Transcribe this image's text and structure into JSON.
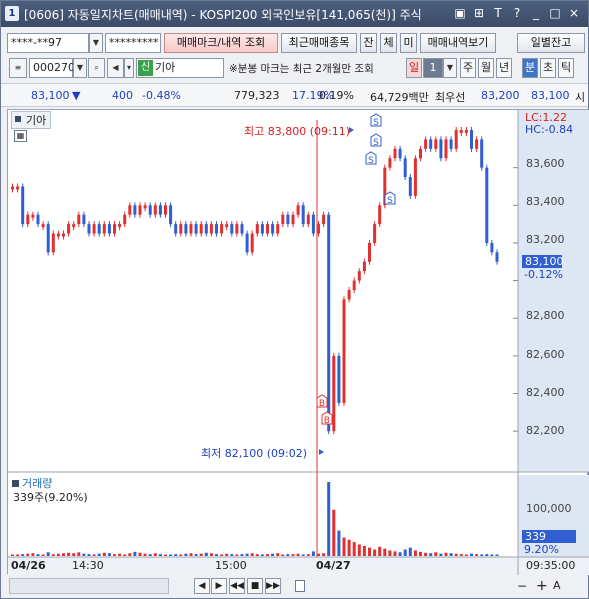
{
  "window": {
    "number": "1",
    "title": "[0606] 자동일지차트(매매내역) - KOSPI200 외국인보유[141,065(천)] 주식",
    "icons": [
      "window-icon",
      "pin-icon",
      "font-icon",
      "help-icon",
      "minimize-icon",
      "maximize-icon",
      "close-icon"
    ],
    "icon_glyphs": [
      "▣",
      "⊞",
      "T",
      "T",
      "?",
      "_",
      "□",
      "×"
    ]
  },
  "toolbar1": {
    "account": "****-**97",
    "password": "*********",
    "trade_mark_button": "매매마크/내역 조회",
    "recent_trades_button": "최근매매종목",
    "balance_button": "잔",
    "fill_button": "체",
    "unfilled_button": "미",
    "trade_history_button": "매매내역보기",
    "daily_balance_button": "일별잔고"
  },
  "toolbar2": {
    "stock_code": "000270",
    "credit_badge": "신",
    "stock_name": "기아",
    "notice": "※분봉 마크는 최근 2개월만 조회",
    "period_buttons": [
      "일",
      "주",
      "월",
      "년",
      "분",
      "초",
      "틱"
    ],
    "period_value": "1",
    "active_period": "분"
  },
  "quote": {
    "price": "83,100",
    "change_arrow": "▼",
    "change": "400",
    "change_rate": "-0.48%",
    "volume": "779,323",
    "foreign_ratio": "17.19%",
    "turnover_rate": "0.19%",
    "trade_value": "64,729백만",
    "best_label": "최우선",
    "best_ask": "83,200",
    "best_bid": "83,100",
    "overflow": "시"
  },
  "chart_panel": {
    "title": "기아",
    "lc_label": "LC:1.22",
    "hc_label": "HC:-0.84",
    "high_label": "최고 83,800 (09:11)",
    "low_label": "최저 82,100 (09:02)",
    "current_price_label": "83,100",
    "current_change_label": "-0.12%",
    "volume_title": "거래량",
    "volume_info": "339주(9.20%)",
    "volume_current_label": "339",
    "volume_current_pct": "9.20%",
    "y_tick_labels": [
      "83,600",
      "83,400",
      "83,200",
      "83,000",
      "82,800",
      "82,600",
      "82,400",
      "82,200"
    ],
    "volume_tick_labels": [
      "100,000"
    ],
    "x_labels": [
      "04/26",
      "14:30",
      "15:00",
      "04/27",
      "09:35:00"
    ],
    "colors": {
      "up": "#e03030",
      "down": "#2f5fd0",
      "axis_bg": "#dde7f3",
      "cursor_line": "#e03030"
    }
  },
  "bottombar": {
    "controls": [
      "◀",
      "▶",
      "◀◀",
      "■",
      "▶▶",
      "−",
      "+",
      "A"
    ]
  },
  "chart_data": {
    "type": "bar",
    "title": "기아",
    "ylim": [
      82100,
      83800
    ],
    "y_ticks": [
      82200,
      82400,
      82600,
      82800,
      83000,
      83200,
      83400,
      83600
    ],
    "price_marks": [
      {
        "label": "최고",
        "price": 83800,
        "time": "09:11"
      },
      {
        "label": "최저",
        "price": 82100,
        "time": "09:02"
      }
    ],
    "trade_marks": [
      {
        "type": "S",
        "time": "09:11",
        "price": 83750
      },
      {
        "type": "S",
        "time": "09:10",
        "price": 83700
      },
      {
        "type": "S",
        "time": "09:10",
        "price": 83650
      },
      {
        "type": "S",
        "time": "09:12",
        "price": 83450
      },
      {
        "type": "B",
        "time": "09:02",
        "price": 82290
      },
      {
        "type": "B",
        "time": "09:02",
        "price": 82190
      }
    ],
    "current_price": 83100,
    "series": [
      {
        "name": "가격",
        "values": [
          83500,
          83500,
          83300,
          83350,
          83350,
          83300,
          83300,
          83150,
          83250,
          83250,
          83250,
          83300,
          83300,
          83350,
          83300,
          83250,
          83300,
          83250,
          83300,
          83250,
          83300,
          83300,
          83350,
          83400,
          83350,
          83400,
          83400,
          83350,
          83400,
          83350,
          83400,
          83300,
          83250,
          83300,
          83250,
          83300,
          83250,
          83300,
          83250,
          83300,
          83250,
          83300,
          83300,
          83250,
          83300,
          83250,
          83150,
          83250,
          83300,
          83250,
          83300,
          83250,
          83300,
          83350,
          83300,
          83350,
          83400,
          83300,
          83350,
          83250,
          83300,
          83350,
          82200,
          82600,
          82350,
          82900,
          82950,
          83000,
          83050,
          83100,
          83200,
          83300,
          83400,
          83600,
          83650,
          83700,
          83650,
          83550,
          83450,
          83650,
          83700,
          83750,
          83700,
          83750,
          83650,
          83750,
          83700,
          83800,
          83800,
          83800,
          83700,
          83750,
          83600,
          83200,
          83150,
          83100
        ]
      }
    ],
    "volume_series": [
      {
        "name": "거래량",
        "values": [
          2,
          3,
          4,
          5,
          6,
          4,
          3,
          8,
          4,
          5,
          6,
          7,
          6,
          8,
          5,
          4,
          3,
          5,
          7,
          6,
          4,
          5,
          3,
          6,
          9,
          7,
          5,
          4,
          6,
          4,
          3,
          2,
          4,
          3,
          5,
          6,
          4,
          5,
          7,
          6,
          4,
          3,
          5,
          4,
          3,
          4,
          5,
          6,
          4,
          3,
          4,
          5,
          6,
          3,
          4,
          4,
          5,
          3,
          4,
          10,
          5,
          6,
          160,
          100,
          55,
          40,
          35,
          30,
          25,
          22,
          18,
          14,
          20,
          16,
          12,
          10,
          8,
          14,
          18,
          12,
          9,
          7,
          6,
          8,
          5,
          7,
          6,
          5,
          4,
          3,
          5,
          4,
          3,
          4,
          3,
          2
        ],
        "ylim": [
          0,
          120000
        ]
      }
    ],
    "x_labels": [
      "04/26",
      "14:30",
      "15:00",
      "04/27"
    ]
  }
}
